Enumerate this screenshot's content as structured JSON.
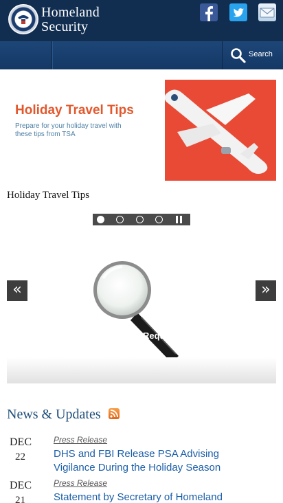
{
  "header": {
    "brand_line1": "Homeland",
    "brand_line2": "Security"
  },
  "navbar": {
    "search_label": "Search"
  },
  "slideshow": {
    "slide_title": "Holiday Travel Tips",
    "slide_subtitle": "Prepare for your holiday travel with these tips from TSA",
    "caption": "Holiday Travel Tips",
    "pager_count": 4,
    "active_index": 0
  },
  "carousel": {
    "prev_glyph": "«",
    "next_glyph": "»",
    "partial_text": "Reque"
  },
  "news": {
    "title": "News & Updates",
    "items": [
      {
        "month": "DEC",
        "day": "22",
        "type": "Press Release",
        "headline": "DHS and FBI Release PSA Advising Vigilance During the Holiday Season"
      },
      {
        "month": "DEC",
        "day": "21",
        "type": "Press Release",
        "headline": "Statement by Secretary of Homeland"
      }
    ]
  },
  "colors": {
    "header_bg": "#112e51",
    "nav_bg": "#1d4677",
    "link": "#1a5ea8",
    "accent_orange": "#e2582d"
  }
}
